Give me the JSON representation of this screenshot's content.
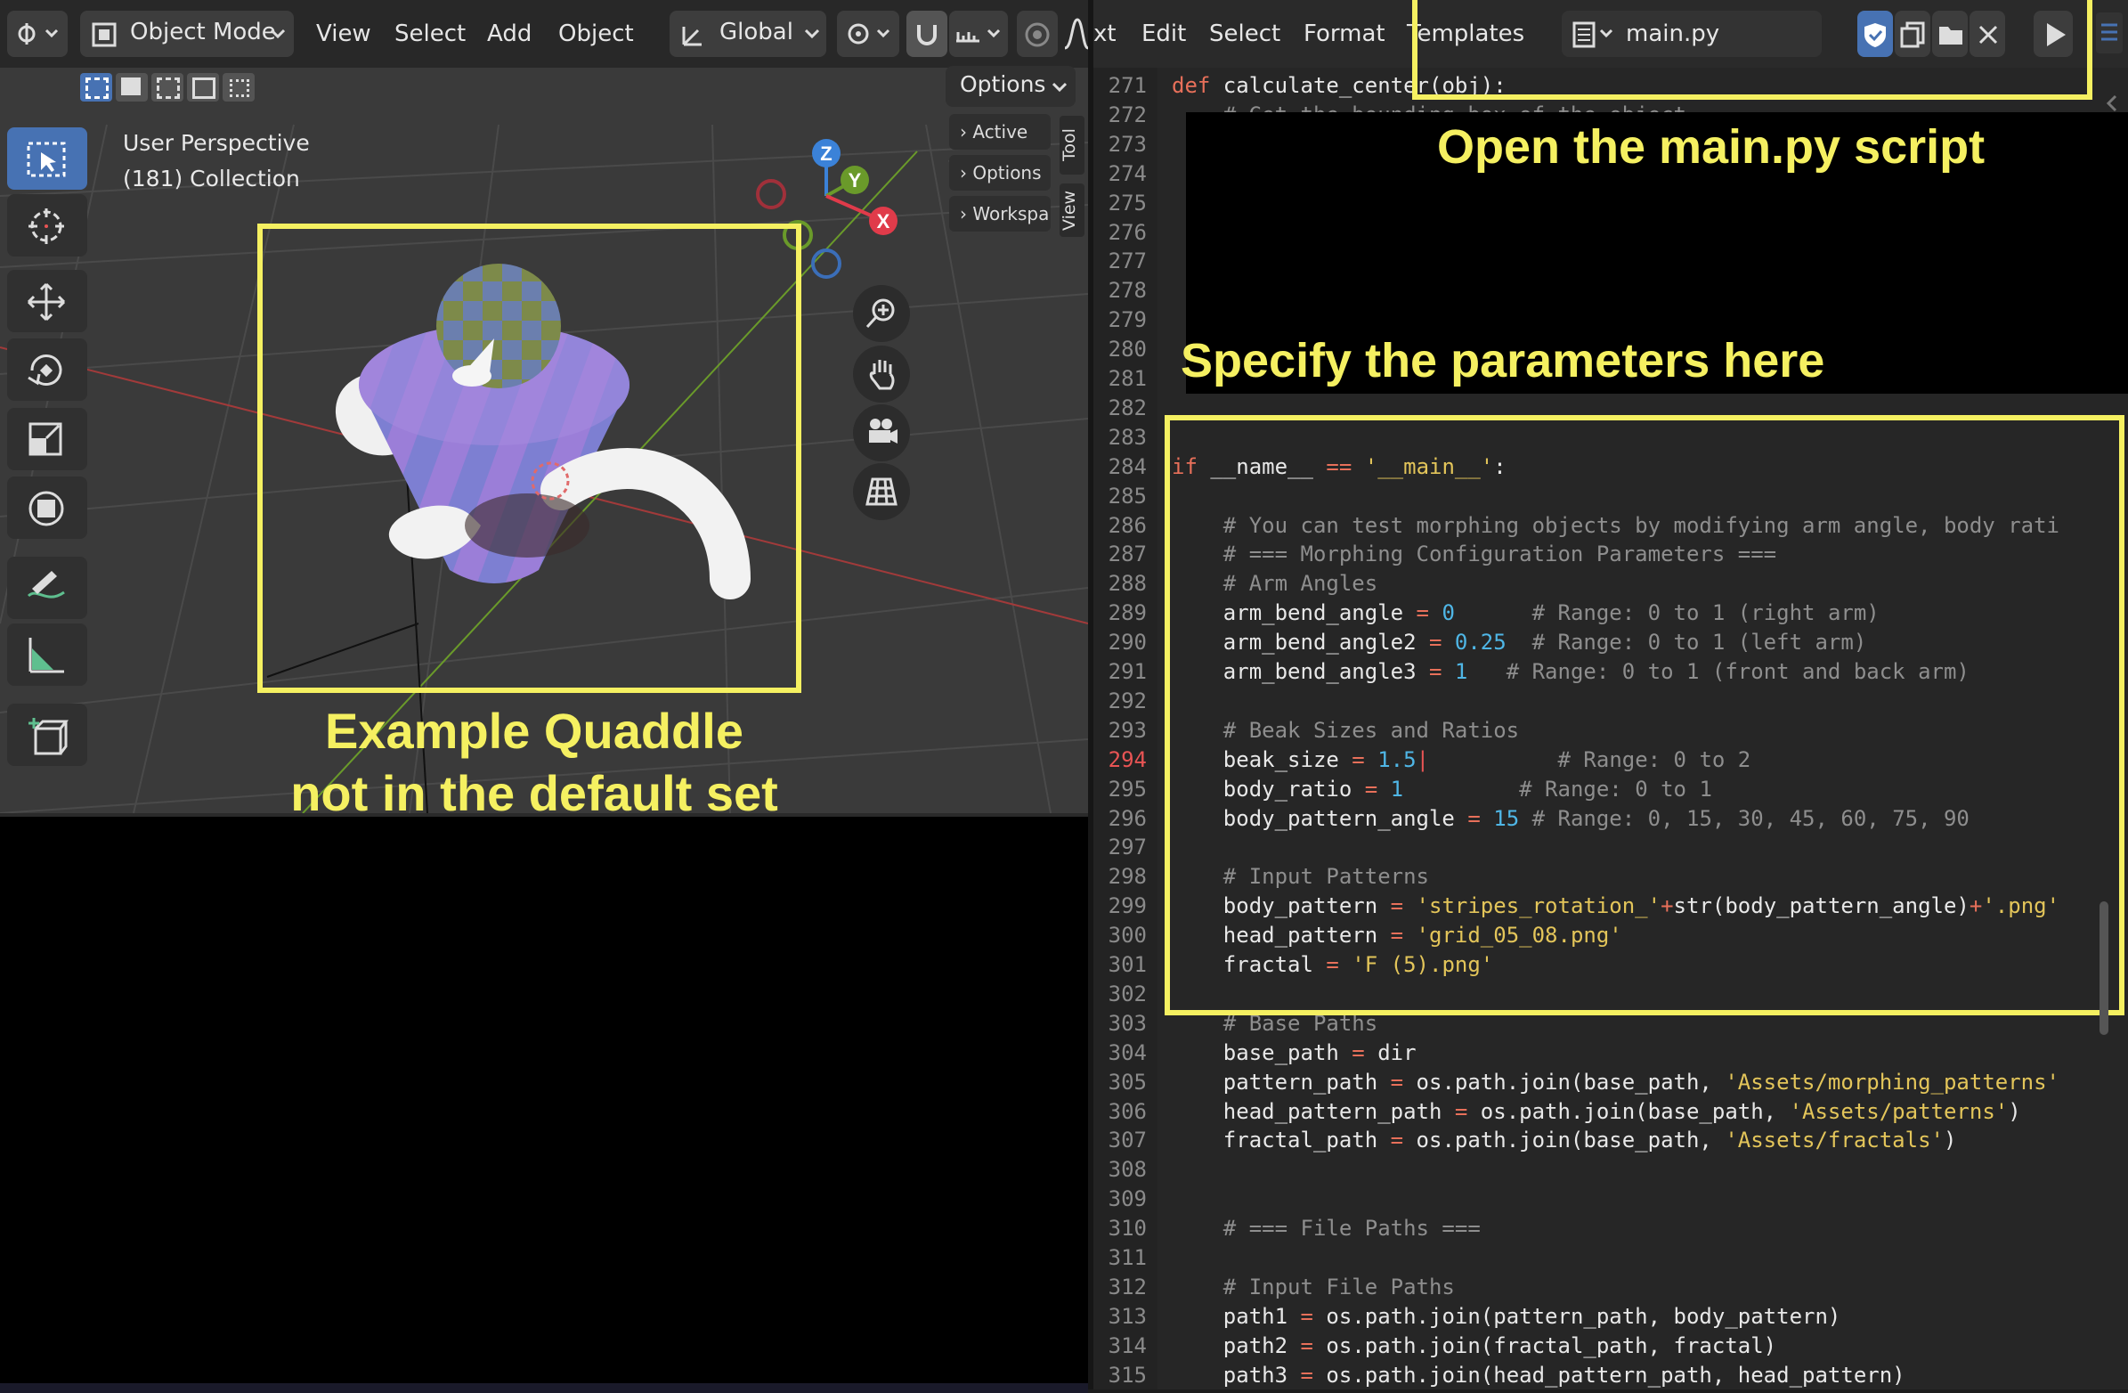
{
  "viewport": {
    "mode_label": "Object Mode",
    "menu": [
      "View",
      "Select",
      "Add",
      "Object"
    ],
    "orientation_label": "Global",
    "options_label": "Options",
    "perspective_label": "User Perspective",
    "collection_label": "(181) Collection",
    "side_tabs": [
      "Active To",
      "Options",
      "Workspa"
    ],
    "vertical_tabs": [
      "Tool",
      "View"
    ],
    "gizmo_axes": {
      "x": "X",
      "y": "Y",
      "z": "Z"
    },
    "tools": [
      "select-box",
      "cursor",
      "move",
      "rotate",
      "scale",
      "transform",
      "annotate",
      "measure",
      "add-cube"
    ],
    "nav_buttons": [
      "zoom",
      "pan",
      "camera",
      "grid"
    ]
  },
  "annotations": {
    "example": [
      "Example Quaddle",
      "not in the default set"
    ],
    "open_script": "Open the main.py script",
    "specify_params": "Specify the parameters here"
  },
  "editor": {
    "menu": [
      "xt",
      "Edit",
      "Select",
      "Format",
      "Templates"
    ],
    "filename": "main.py",
    "lines": [
      {
        "n": "271",
        "html": "<span class='k'>def</span> calculate_center(obj):"
      },
      {
        "n": "272",
        "html": "    <span class='c'># Get the bounding box of the object</span>"
      },
      {
        "n": "273",
        "html": ""
      },
      {
        "n": "274",
        "html": ""
      },
      {
        "n": "275",
        "html": ""
      },
      {
        "n": "276",
        "html": ""
      },
      {
        "n": "277",
        "html": ""
      },
      {
        "n": "278",
        "html": ""
      },
      {
        "n": "279",
        "html": ""
      },
      {
        "n": "280",
        "html": ""
      },
      {
        "n": "281",
        "html": ""
      },
      {
        "n": "282",
        "html": ""
      },
      {
        "n": "283",
        "html": ""
      },
      {
        "n": "284",
        "html": "<span class='k'>if</span> __name__ <span class='k'>==</span> <span class='s'>'__main__'</span>:"
      },
      {
        "n": "285",
        "html": ""
      },
      {
        "n": "286",
        "html": "    <span class='c'># You can test morphing objects by modifying arm angle, body rati</span>"
      },
      {
        "n": "287",
        "html": "    <span class='c'># === Morphing Configuration Parameters ===</span>"
      },
      {
        "n": "288",
        "html": "    <span class='c'># Arm Angles</span>"
      },
      {
        "n": "289",
        "html": "    arm_bend_angle <span class='k'>=</span> <span class='n'>0</span>      <span class='c'># Range: 0 to 1 (right arm)</span>"
      },
      {
        "n": "290",
        "html": "    arm_bend_angle2 <span class='k'>=</span> <span class='n'>0.25</span>  <span class='c'># Range: 0 to 1 (left arm)</span>"
      },
      {
        "n": "291",
        "html": "    arm_bend_angle3 <span class='k'>=</span> <span class='n'>1</span>   <span class='c'># Range: 0 to 1 (front and back arm)</span>"
      },
      {
        "n": "292",
        "html": ""
      },
      {
        "n": "293",
        "html": "    <span class='c'># Beak Sizes and Ratios</span>"
      },
      {
        "n": "294",
        "html": "    beak_size <span class='k'>=</span> <span class='n'>1.5</span><span style='color:#e85454'>|</span>          <span class='c'># Range: 0 to 2</span>"
      },
      {
        "n": "295",
        "html": "    body_ratio <span class='k'>=</span> <span class='n'>1</span>         <span class='c'># Range: 0 to 1</span>"
      },
      {
        "n": "296",
        "html": "    body_pattern_angle <span class='k'>=</span> <span class='n'>15</span> <span class='c'># Range: 0, 15, 30, 45, 60, 75, 90</span>"
      },
      {
        "n": "297",
        "html": ""
      },
      {
        "n": "298",
        "html": "    <span class='c'># Input Patterns</span>"
      },
      {
        "n": "299",
        "html": "    body_pattern <span class='k'>=</span> <span class='s'>'stripes_rotation_'</span><span class='k'>+</span>str(body_pattern_angle)<span class='k'>+</span><span class='s'>'.png'</span>"
      },
      {
        "n": "300",
        "html": "    head_pattern <span class='k'>=</span> <span class='s'>'grid_05_08.png'</span>"
      },
      {
        "n": "301",
        "html": "    fractal <span class='k'>=</span> <span class='s'>'F (5).png'</span>"
      },
      {
        "n": "302",
        "html": ""
      },
      {
        "n": "303",
        "html": "    <span class='c'># Base Paths</span>"
      },
      {
        "n": "304",
        "html": "    base_path <span class='k'>=</span> dir"
      },
      {
        "n": "305",
        "html": "    pattern_path <span class='k'>=</span> os.path.join(base_path, <span class='s'>'Assets/morphing_patterns'</span>"
      },
      {
        "n": "306",
        "html": "    head_pattern_path <span class='k'>=</span> os.path.join(base_path, <span class='s'>'Assets/patterns'</span>)"
      },
      {
        "n": "307",
        "html": "    fractal_path <span class='k'>=</span> os.path.join(base_path, <span class='s'>'Assets/fractals'</span>)"
      },
      {
        "n": "308",
        "html": ""
      },
      {
        "n": "309",
        "html": ""
      },
      {
        "n": "310",
        "html": "    <span class='c'># === File Paths ===</span>"
      },
      {
        "n": "311",
        "html": ""
      },
      {
        "n": "312",
        "html": "    <span class='c'># Input File Paths</span>"
      },
      {
        "n": "313",
        "html": "    path1 <span class='k'>=</span> os.path.join(pattern_path, body_pattern)"
      },
      {
        "n": "314",
        "html": "    path2 <span class='k'>=</span> os.path.join(fractal_path, fractal)"
      },
      {
        "n": "315",
        "html": "    path3 <span class='k'>=</span> os.path.join(head_pattern_path, head_pattern)"
      }
    ],
    "current_line": "294"
  }
}
